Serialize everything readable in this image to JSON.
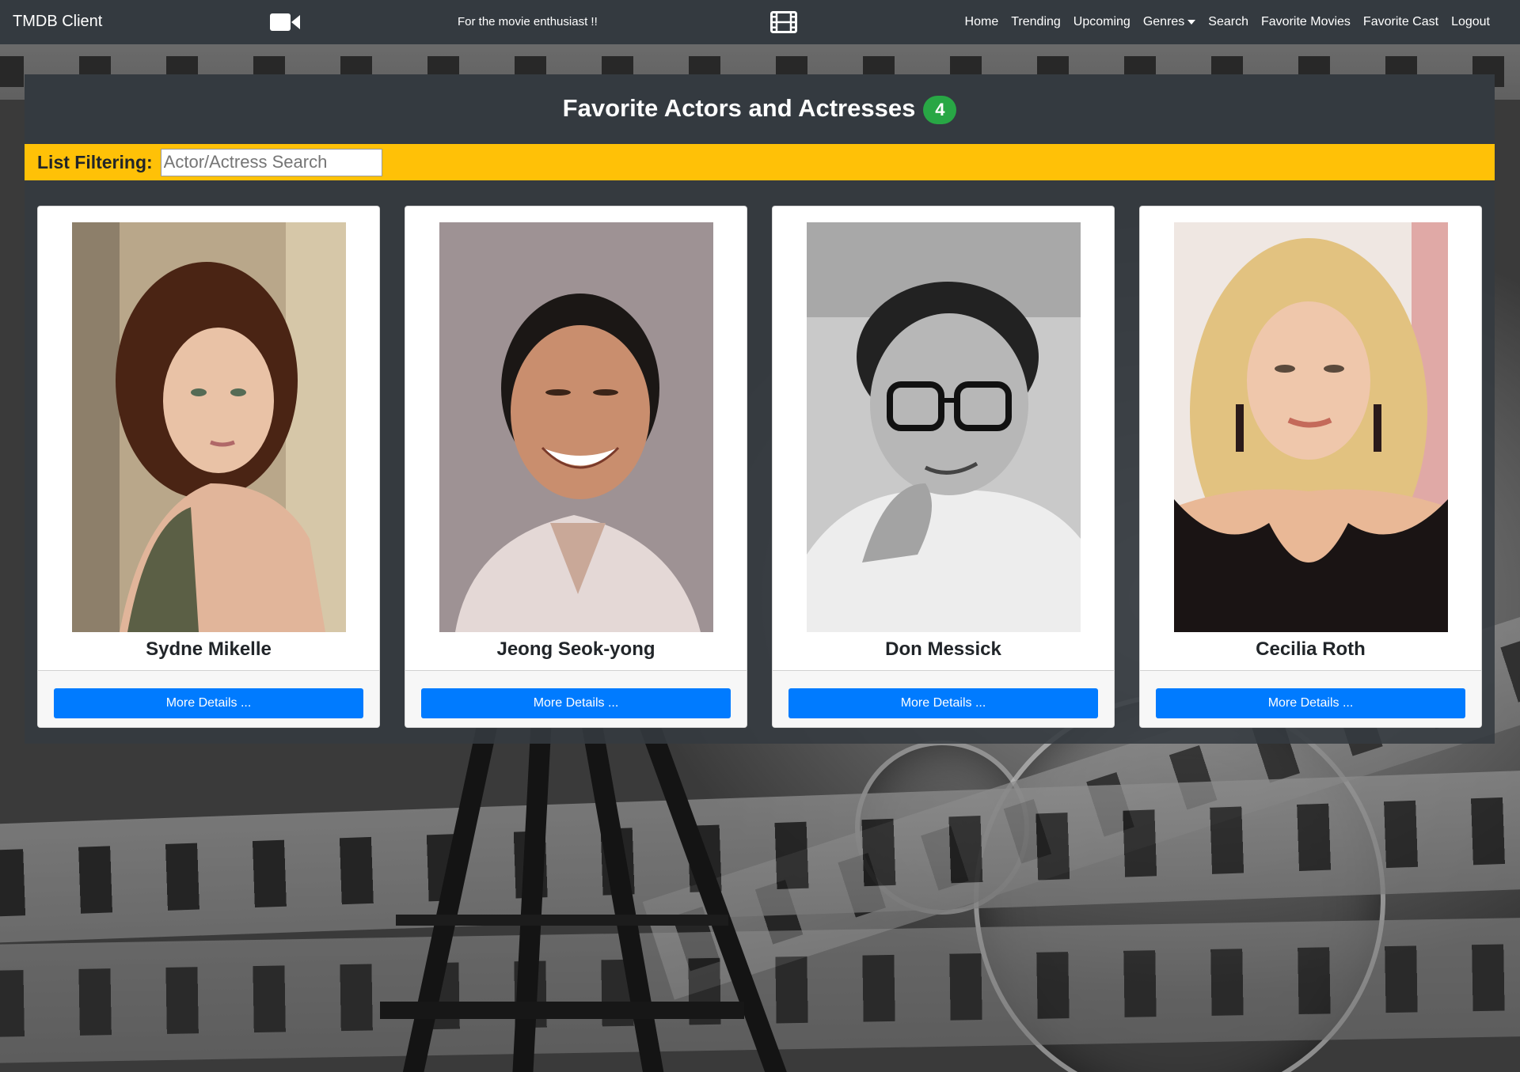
{
  "navbar": {
    "brand": "TMDB Client",
    "tagline": "For the movie enthusiast !!",
    "links": [
      {
        "label": "Home"
      },
      {
        "label": "Trending"
      },
      {
        "label": "Upcoming"
      },
      {
        "label": "Genres"
      },
      {
        "label": "Search"
      },
      {
        "label": "Favorite Movies"
      },
      {
        "label": "Favorite Cast"
      },
      {
        "label": "Logout"
      }
    ],
    "icons": [
      "video-camera-icon",
      "film-icon",
      "dropdown-caret-icon"
    ]
  },
  "panel": {
    "title": "Favorite Actors and Actresses",
    "count": "4"
  },
  "filter": {
    "label": "List Filtering:",
    "placeholder": "Actor/Actress Search",
    "value": ""
  },
  "cards": [
    {
      "name": "Sydne Mikelle",
      "button": "More Details ..."
    },
    {
      "name": "Jeong Seok-yong",
      "button": "More Details ..."
    },
    {
      "name": "Don Messick",
      "button": "More Details ..."
    },
    {
      "name": "Cecilia Roth",
      "button": "More Details ..."
    }
  ],
  "colors": {
    "navbar": "#343a40",
    "filter_bar": "#ffc107",
    "badge": "#28a745",
    "button": "#007bff"
  }
}
